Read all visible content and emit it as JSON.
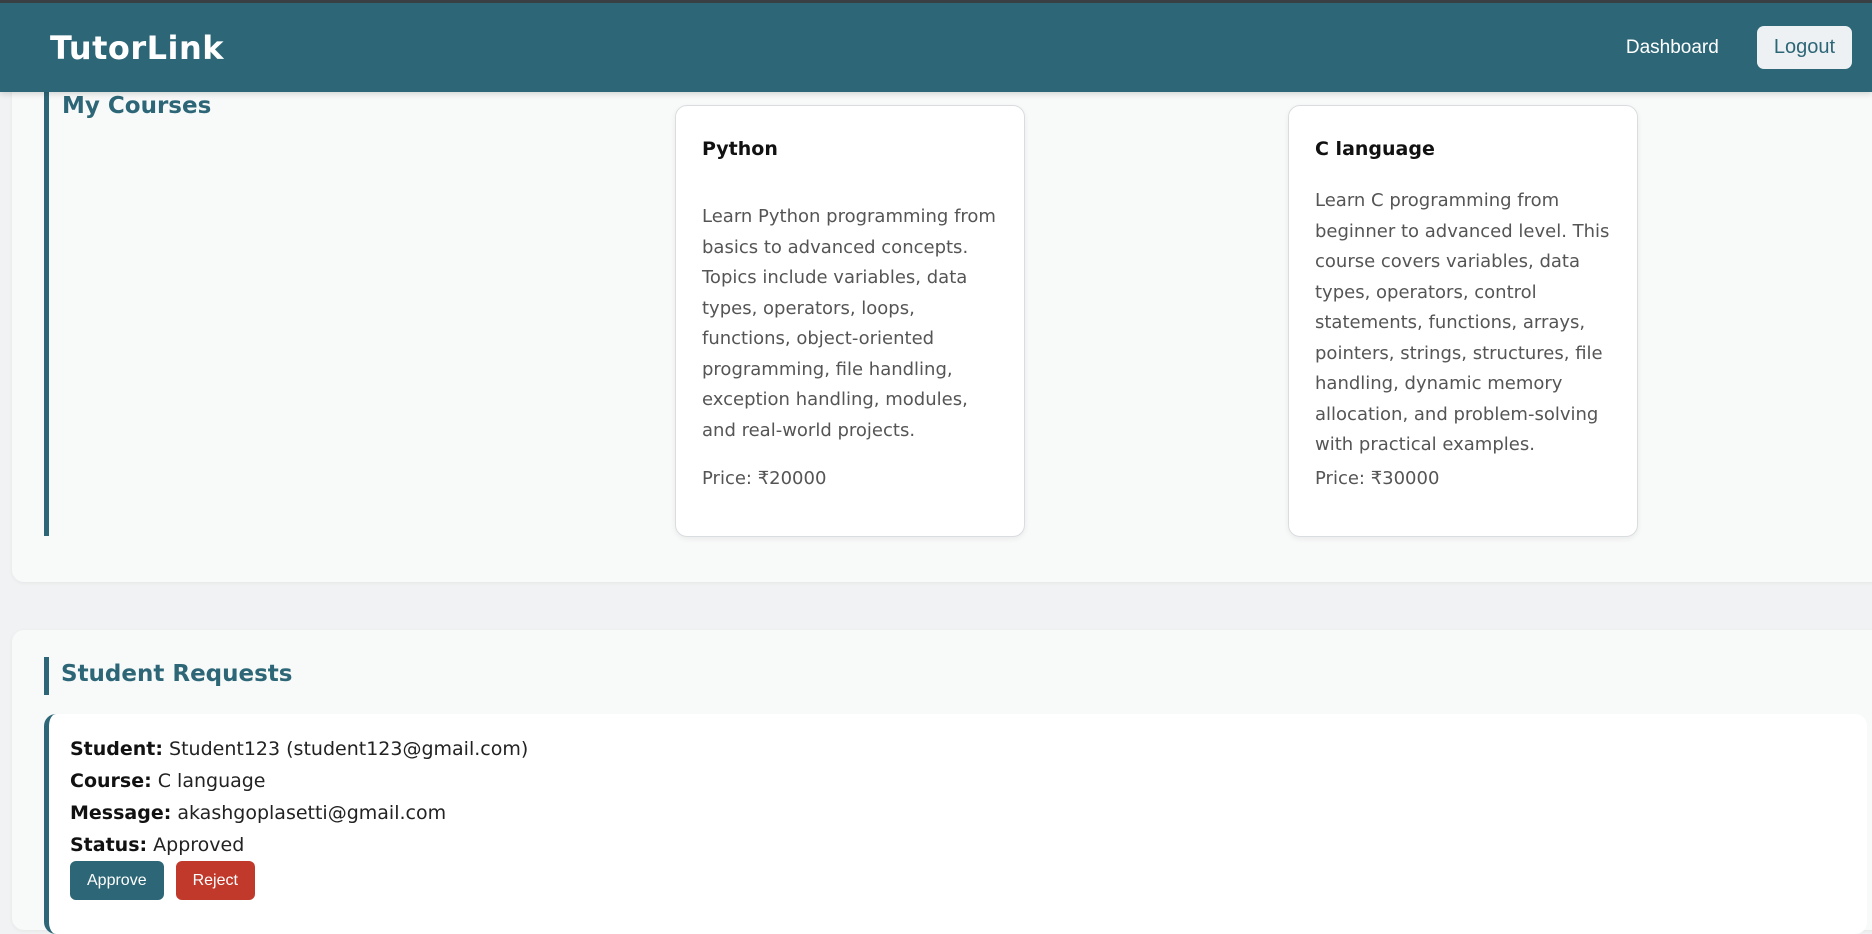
{
  "navbar": {
    "brand": "TutorLink",
    "dashboard_label": "Dashboard",
    "logout_label": "Logout"
  },
  "courses": {
    "title": "My Courses",
    "items": [
      {
        "name": "Python",
        "description": "Learn Python programming from basics to advanced concepts. Topics include variables, data types, operators, loops, functions, object-oriented programming, file handling, exception handling, modules, and real-world projects.",
        "price": "Price: ₹20000"
      },
      {
        "name": "C language",
        "description": "Learn C programming from beginner to advanced level. This course covers variables, data types, operators, control statements, functions, arrays, pointers, strings, structures, file handling, dynamic memory allocation, and problem-solving with practical examples.",
        "price": "Price: ₹30000"
      }
    ]
  },
  "requests": {
    "title": "Student Requests",
    "items": [
      {
        "student_label": "Student:",
        "student_value": "Student123 (student123@gmail.com)",
        "course_label": "Course:",
        "course_value": "C language",
        "message_label": "Message:",
        "message_value": "akashgoplasetti@gmail.com",
        "status_label": "Status:",
        "status_value": "Approved",
        "approve_label": "Approve",
        "reject_label": "Reject"
      }
    ]
  },
  "colors": {
    "primary": "#2d6777",
    "danger": "#c0392b"
  }
}
